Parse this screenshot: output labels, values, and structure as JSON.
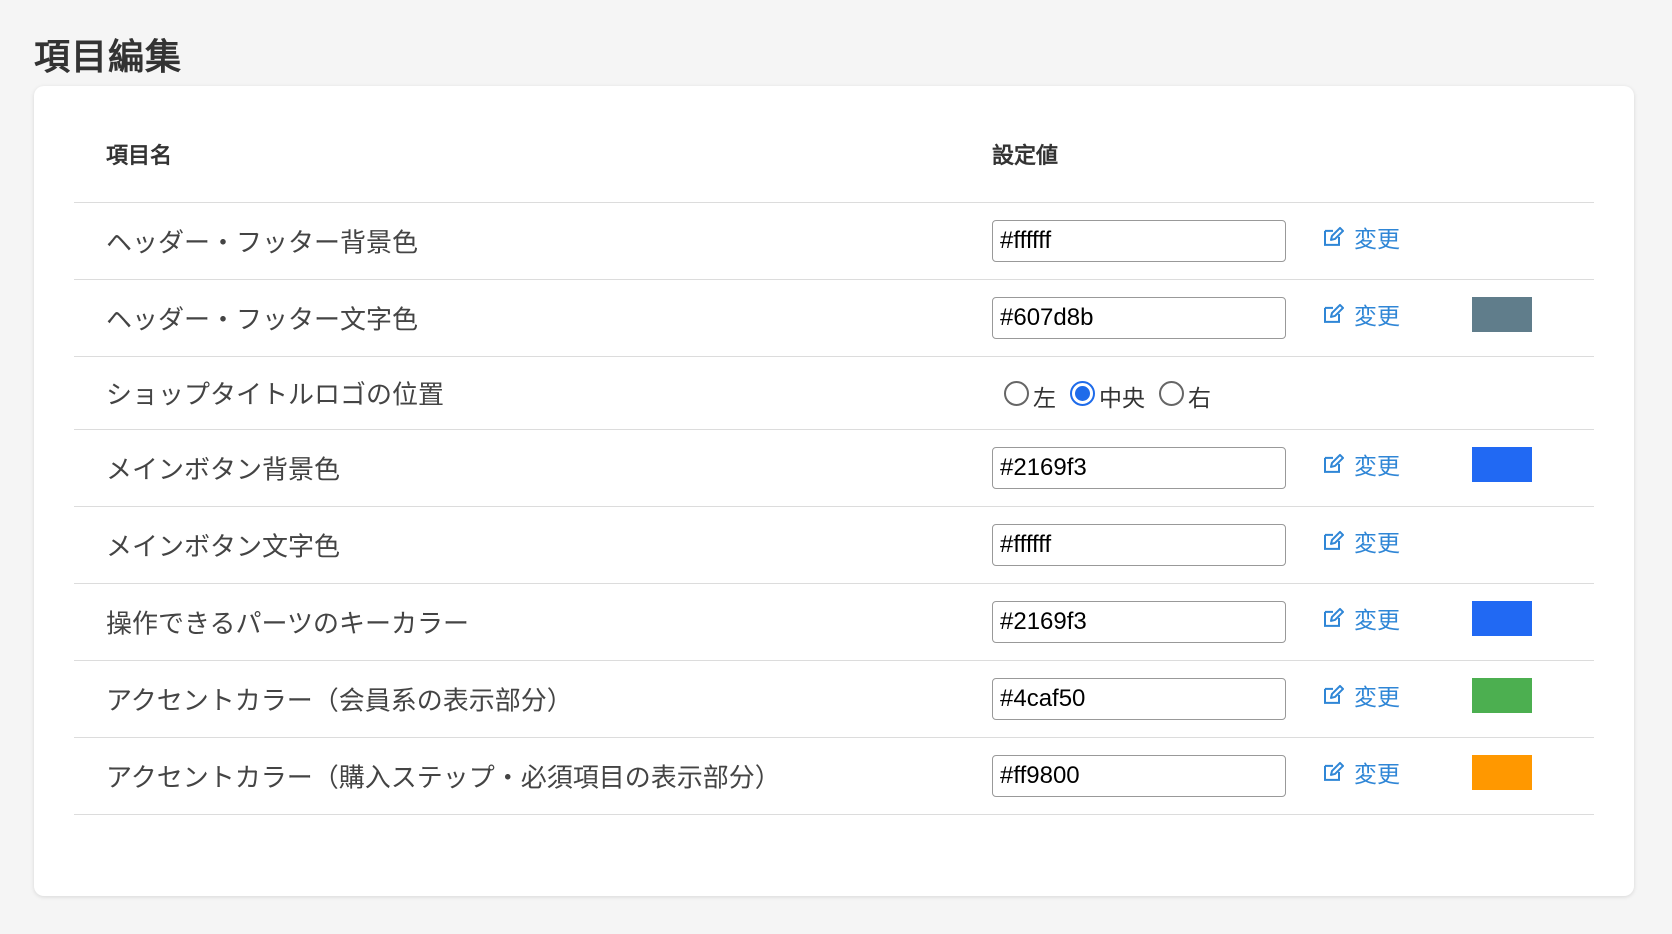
{
  "page_title": "項目編集",
  "table": {
    "header_name": "項目名",
    "header_value": "設定値",
    "change_label": "変更",
    "rows": [
      {
        "name": "ヘッダー・フッター背景色",
        "value": "#ffffff",
        "swatch": "#ffffff"
      },
      {
        "name": "ヘッダー・フッター文字色",
        "value": "#607d8b",
        "swatch": "#607d8b"
      },
      {
        "name": "ショップタイトルロゴの位置",
        "options": [
          "左",
          "中央",
          "右"
        ],
        "selected": "中央"
      },
      {
        "name": "メインボタン背景色",
        "value": "#2169f3",
        "swatch": "#2169f3"
      },
      {
        "name": "メインボタン文字色",
        "value": "#ffffff",
        "swatch": "#ffffff"
      },
      {
        "name": "操作できるパーツのキーカラー",
        "value": "#2169f3",
        "swatch": "#2169f3"
      },
      {
        "name": "アクセントカラー（会員系の表示部分）",
        "value": "#4caf50",
        "swatch": "#4caf50"
      },
      {
        "name": "アクセントカラー（購入ステップ・必須項目の表示部分）",
        "value": "#ff9800",
        "swatch": "#ff9800"
      }
    ]
  }
}
